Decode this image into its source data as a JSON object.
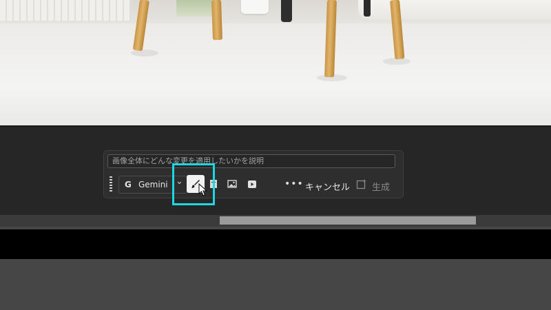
{
  "prompt": {
    "placeholder": "画像全体にどんな変更を適用したいかを説明"
  },
  "toolbar": {
    "model_label": "Gemini",
    "model_logo": "G",
    "chevron": "⌄",
    "more_label": "•••",
    "cancel_label": "キャンセル",
    "generate_label": "生成"
  },
  "icons": {
    "grip": "drag-handle-icon",
    "brush": "brush-icon",
    "document": "document-icon",
    "image": "image-icon",
    "video": "video-icon",
    "generate": "generate-icon"
  },
  "colors": {
    "highlight": "#1bd8e4",
    "panel_bg": "#2e2e2e",
    "editor_bg": "#262626"
  }
}
